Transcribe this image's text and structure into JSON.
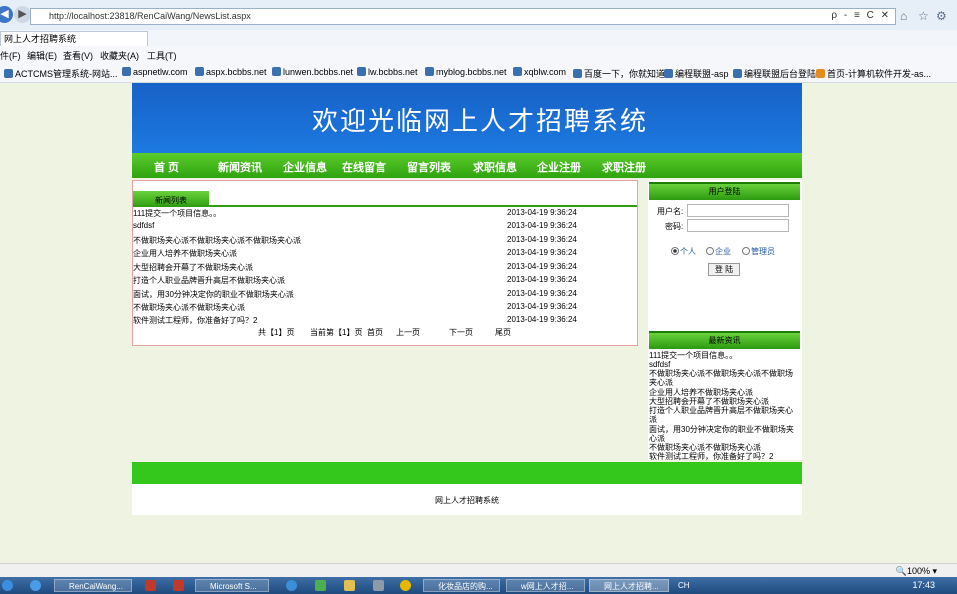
{
  "browser": {
    "url": "http://localhost:23818/RenCaiWang/NewsList.aspx",
    "tab_title": "网上人才招聘系统",
    "addr_controls": "ρ - ≡ C ✕",
    "menu": [
      "件(F)",
      "编辑(E)",
      "查看(V)",
      "收藏夹(A)",
      "工具(T)"
    ],
    "favorites": [
      "ACTCMS管理系统-网站...",
      "aspnetlw.com",
      "aspx.bcbbs.net",
      "lunwen.bcbbs.net",
      "lw.bcbbs.net",
      "myblog.bcbbs.net",
      "xqblw.com",
      "百度一下，你就知道",
      "编程联盟-asp",
      "编程联盟后台登陆",
      "首页-计算机软件开发-as..."
    ]
  },
  "banner": {
    "title": "欢迎光临网上人才招聘系统"
  },
  "nav": [
    "首 页",
    "新闻资讯",
    "企业信息",
    "在线留言",
    "留言列表",
    "求职信息",
    "企业注册",
    "求职注册"
  ],
  "news": {
    "tab_label": "新闻列表",
    "rows": [
      {
        "title": "111提交一个项目信息。。",
        "date": "2013-04-19 9:36:24"
      },
      {
        "title": "sdfdsf",
        "date": "2013-04-19 9:36:24"
      },
      {
        "title": "不做职场夹心派不做职场夹心派不做职场夹心派",
        "date": "2013-04-19 9:36:24"
      },
      {
        "title": "企业用人培养不做职场夹心派",
        "date": "2013-04-19 9:36:24"
      },
      {
        "title": "大型招聘会开幕了不做职场夹心派",
        "date": "2013-04-19 9:36:24"
      },
      {
        "title": "打造个人职业品牌晋升高层不做职场夹心派",
        "date": "2013-04-19 9:36:24"
      },
      {
        "title": "面试，用30分钟决定你的职业不做职场夹心派",
        "date": "2013-04-19 9:36:24"
      },
      {
        "title": "不做职场夹心派不做职场夹心派",
        "date": "2013-04-19 9:36:24"
      },
      {
        "title": "软件测试工程师，你准备好了吗？2",
        "date": "2013-04-19 9:36:24"
      }
    ],
    "pager": {
      "total": "共【1】页",
      "current": "当前第【1】页",
      "first": "首页",
      "prev": "上一页",
      "next": "下一页",
      "last": "尾页"
    }
  },
  "login": {
    "header": "用户登陆",
    "username_label": "用户名:",
    "password_label": "密码:",
    "roles": [
      "个人",
      "企业",
      "管理员"
    ],
    "selected_role": "个人",
    "button": "登 陆"
  },
  "latest": {
    "header": "最新资讯",
    "items": [
      "111提交一个项目信息。。",
      "sdfdsf",
      "不做职场夹心派不做职场夹心派不做职场夹心派",
      "企业用人培养不做职场夹心派",
      "大型招聘会开幕了不做职场夹心派",
      "打造个人职业品牌晋升高层不做职场夹心派",
      "面试，用30分钟决定你的职业不做职场夹心派",
      "不做职场夹心派不做职场夹心派",
      "软件测试工程师，你准备好了吗？2"
    ]
  },
  "footer": {
    "text": "网上人才招聘系统"
  },
  "status": {
    "zoom": "100%"
  },
  "taskbar": {
    "items": [
      "RenCaiWang...",
      "Microsoft S...",
      "化妆品店的购...",
      "w网上人才招...",
      "网上人才招聘..."
    ],
    "tray": "CH",
    "clock": "17:43"
  },
  "colors": {
    "banner": "#1a6fd6",
    "nav": "#2ea30e",
    "footer_bar": "#33c81b",
    "page_bg": "#eef3e2"
  }
}
